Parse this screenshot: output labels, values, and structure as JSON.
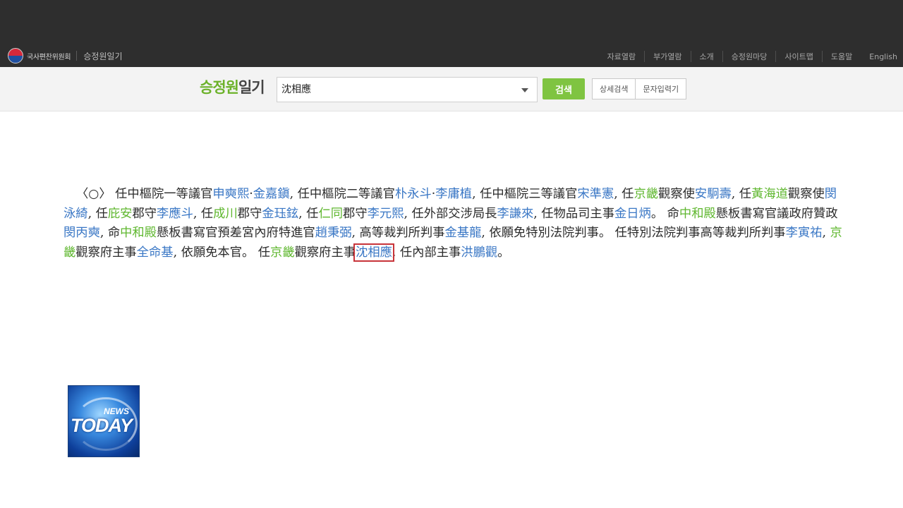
{
  "header": {
    "org_name": "국사편찬위원회",
    "site_name": "승정원일기",
    "nav": [
      "자료열람",
      "부가열람",
      "소개",
      "승정원마당",
      "사이트맵",
      "도움말",
      "English"
    ]
  },
  "search": {
    "title_accent": "승정원",
    "title_rest": "일기",
    "query": "沈相應",
    "search_button": "검색",
    "advanced_button": "상세검색",
    "char_input_button": "문자입력기"
  },
  "document": {
    "segments": [
      {
        "t": "〈○〉 任中樞院一等議官"
      },
      {
        "t": "申奭熙",
        "c": "n"
      },
      {
        "t": "·"
      },
      {
        "t": "金嘉鎭",
        "c": "n"
      },
      {
        "t": ", 任中樞院二等議官"
      },
      {
        "t": "朴永斗",
        "c": "n"
      },
      {
        "t": "·"
      },
      {
        "t": "李庸植",
        "c": "n"
      },
      {
        "t": ", 任中樞院三等議官"
      },
      {
        "t": "宋準憲",
        "c": "n"
      },
      {
        "t": ", 任"
      },
      {
        "t": "京畿",
        "c": "p"
      },
      {
        "t": "觀察使"
      },
      {
        "t": "安駉壽",
        "c": "n"
      },
      {
        "t": ", 任"
      },
      {
        "t": "黃海道",
        "c": "p"
      },
      {
        "t": "觀察使"
      },
      {
        "t": "閔泳綺",
        "c": "n"
      },
      {
        "t": ", 任"
      },
      {
        "t": "庇安",
        "c": "p"
      },
      {
        "t": "郡守"
      },
      {
        "t": "李應斗",
        "c": "n"
      },
      {
        "t": ", 任"
      },
      {
        "t": "成川",
        "c": "p"
      },
      {
        "t": "郡守"
      },
      {
        "t": "金珏鉉",
        "c": "n"
      },
      {
        "t": ", 任"
      },
      {
        "t": "仁同",
        "c": "p"
      },
      {
        "t": "郡守"
      },
      {
        "t": "李元熙",
        "c": "n"
      },
      {
        "t": ", 任外部交涉局長"
      },
      {
        "t": "李謙來",
        "c": "n"
      },
      {
        "t": ", 任物品司主事"
      },
      {
        "t": "金日炳",
        "c": "n"
      },
      {
        "t": "。 命"
      },
      {
        "t": "中和殿",
        "c": "p"
      },
      {
        "t": "懸板書寫官議政府贊政"
      },
      {
        "t": "閔丙奭",
        "c": "n"
      },
      {
        "t": ", 命"
      },
      {
        "t": "中和殿",
        "c": "p"
      },
      {
        "t": "懸板書寫官預差宮內府特進官"
      },
      {
        "t": "趙秉弼",
        "c": "n"
      },
      {
        "t": ", 高等裁判所判事"
      },
      {
        "t": "金基龍",
        "c": "n"
      },
      {
        "t": ", 依願免特別法院判事。 任特別法院判事高等裁判所判事"
      },
      {
        "t": "李寅祐",
        "c": "n"
      },
      {
        "t": ", "
      },
      {
        "t": "京畿",
        "c": "p"
      },
      {
        "t": "觀察府主事"
      },
      {
        "t": "全命基",
        "c": "n"
      },
      {
        "t": ", 依願免本官。 任"
      },
      {
        "t": "京畿",
        "c": "p"
      },
      {
        "t": "觀察府主事"
      },
      {
        "t": "沈相應",
        "c": "hl"
      },
      {
        "t": ", 任內部主事"
      },
      {
        "t": "洪鵬觀",
        "c": "n"
      },
      {
        "t": "。"
      }
    ]
  },
  "overlay": {
    "news_small": "NEWS",
    "news_big": "TODAY"
  },
  "colors": {
    "topbar": "#2e2e2e",
    "accent_green": "#7fc441",
    "person_name": "#3a77c5",
    "place_name": "#5fb72f",
    "highlight_box": "#c8343a"
  }
}
